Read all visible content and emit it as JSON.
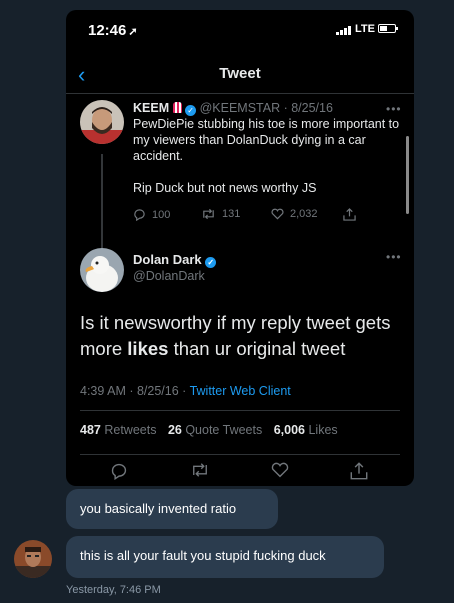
{
  "status_bar": {
    "time": "12:46",
    "network": "LTE"
  },
  "nav": {
    "title": "Tweet"
  },
  "tweet1": {
    "name": "KEEM",
    "handle": "@KEEMSTAR",
    "date": "· 8/25/16",
    "text": "PewDiePie stubbing his toe is more important to my viewers than DolanDuck dying in a car accident.",
    "text2": "Rip Duck but not news worthy JS",
    "replies": "100",
    "retweets": "131",
    "likes": "2,032"
  },
  "tweet2": {
    "name": "Dolan Dark",
    "handle": "@DolanDark",
    "text_before": "Is it newsworthy if my reply tweet gets more ",
    "text_bold": "likes",
    "text_after": " than ur original tweet",
    "time": "4:39 AM · 8/25/16 ·",
    "client": "Twitter Web Client",
    "retweets_count": "487",
    "retweets_label": "Retweets",
    "quotes_count": "26",
    "quotes_label": "Quote Tweets",
    "likes_count": "6,006",
    "likes_label": "Likes"
  },
  "messages": [
    {
      "text": "you basically invented ratio"
    },
    {
      "text": "this is all your fault you stupid fucking duck"
    }
  ],
  "timestamp": "Yesterday, 7:46 PM",
  "colors": {
    "accent": "#1d9bf0",
    "chat_bg": "#17212b",
    "bubble": "#2b3c4e"
  }
}
